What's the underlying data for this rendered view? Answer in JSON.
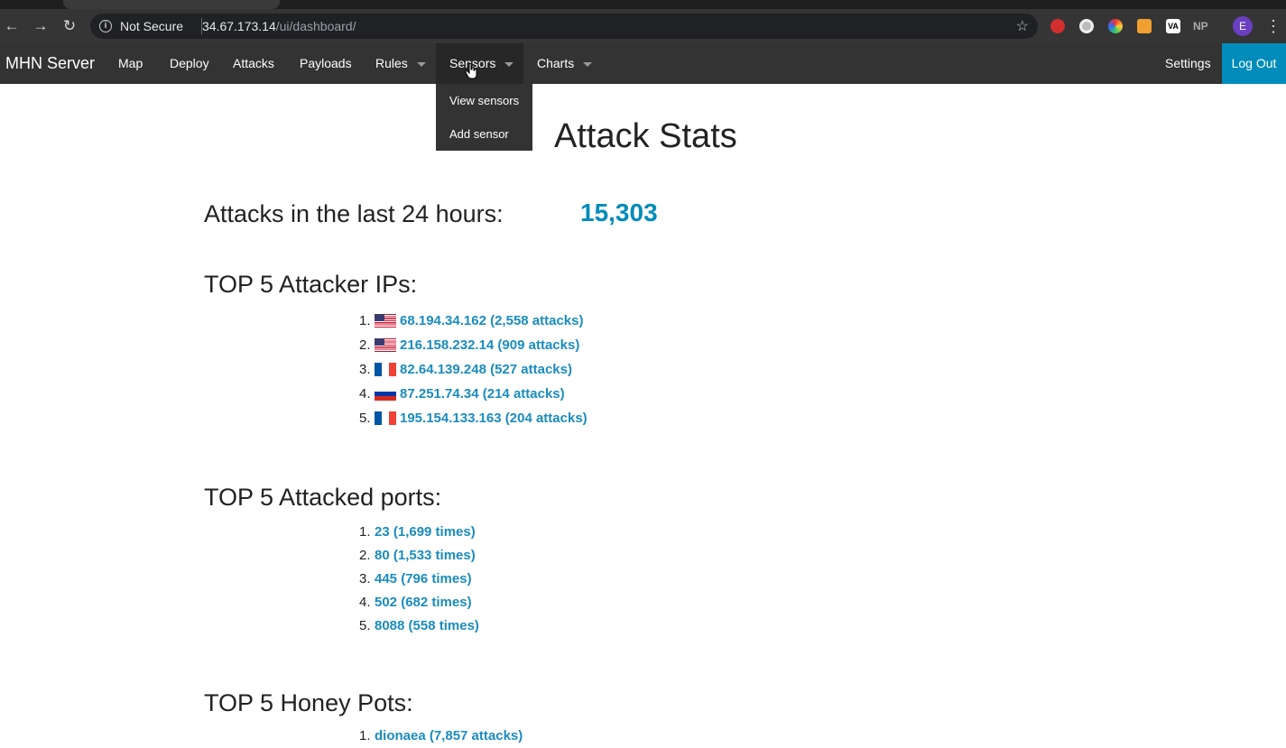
{
  "browser": {
    "security_label": "Not Secure",
    "url_host": "34.67.173.14",
    "url_path": "/ui/dashboard/",
    "avatar_letter": "E",
    "ext_np_label": "NP",
    "ext_va_label": "VA"
  },
  "navbar": {
    "brand": "MHN Server",
    "items": [
      {
        "label": "Map"
      },
      {
        "label": "Deploy"
      },
      {
        "label": "Attacks"
      },
      {
        "label": "Payloads"
      },
      {
        "label": "Rules"
      },
      {
        "label": "Sensors"
      },
      {
        "label": "Charts"
      }
    ],
    "settings": "Settings",
    "logout": "Log Out",
    "sensors_dropdown": [
      "View sensors",
      "Add sensor"
    ]
  },
  "dashboard": {
    "title": "Attack Stats",
    "attacks_label": "Attacks in the last 24 hours:",
    "attacks_count": "15,303",
    "top_ips_title": "TOP 5 Attacker IPs:",
    "top_ips": [
      {
        "num": "1.",
        "flag": "us",
        "text": "68.194.34.162 (2,558 attacks)"
      },
      {
        "num": "2.",
        "flag": "us",
        "text": "216.158.232.14 (909 attacks)"
      },
      {
        "num": "3.",
        "flag": "fr",
        "text": "82.64.139.248 (527 attacks)"
      },
      {
        "num": "4.",
        "flag": "ru",
        "text": "87.251.74.34 (214 attacks)"
      },
      {
        "num": "5.",
        "flag": "fr",
        "text": "195.154.133.163 (204 attacks)"
      }
    ],
    "top_ports_title": "TOP 5 Attacked ports:",
    "top_ports": [
      {
        "num": "1.",
        "text": "23 (1,699 times)"
      },
      {
        "num": "2.",
        "text": "80 (1,533 times)"
      },
      {
        "num": "3.",
        "text": "445 (796 times)"
      },
      {
        "num": "4.",
        "text": "502 (682 times)"
      },
      {
        "num": "5.",
        "text": "8088 (558 times)"
      }
    ],
    "top_honeypots_title": "TOP 5 Honey Pots:",
    "top_honeypots": [
      {
        "num": "1.",
        "text": "dionaea (7,857 attacks)"
      }
    ]
  },
  "colors": {
    "accent": "#008cba",
    "link": "#1a8cbf",
    "navbar_bg": "#333333"
  }
}
